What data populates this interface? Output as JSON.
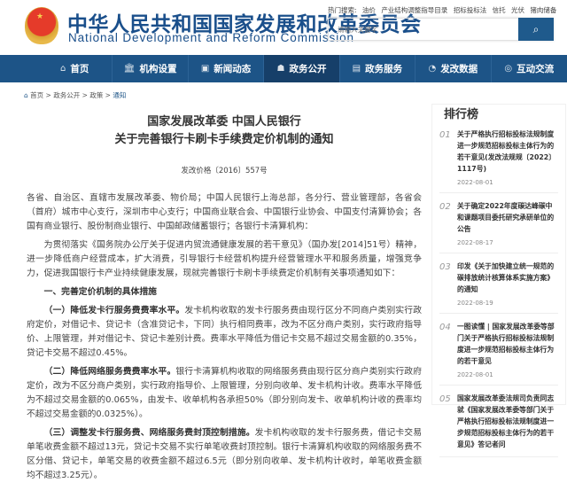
{
  "header": {
    "site_cn": "中华人民共和国国家发展和改革委员会",
    "site_en": "National Development and Reform Commission",
    "hot_label": "热门搜索:",
    "hot_terms": [
      "油价",
      "产业结构调整指导目录",
      "招标投标法",
      "信托",
      "光伏",
      "猪肉储备"
    ],
    "search_placeholder": "请输入关键字"
  },
  "nav": [
    {
      "label": "首页",
      "icon": "⌂"
    },
    {
      "label": "机构设置",
      "icon": "🏛"
    },
    {
      "label": "新闻动态",
      "icon": "▣"
    },
    {
      "label": "政务公开",
      "icon": "☗"
    },
    {
      "label": "政务服务",
      "icon": "▤"
    },
    {
      "label": "发改数据",
      "icon": "◔"
    },
    {
      "label": "互动交流",
      "icon": "◎"
    }
  ],
  "breadcrumb": [
    "首页",
    "政务公开",
    "政策",
    "通知"
  ],
  "article": {
    "title1": "国家发展改革委 中国人民银行",
    "title2": "关于完善银行卡刷卡手续费定价机制的通知",
    "doc_no": "发改价格〔2016〕557号",
    "recipients": "各省、自治区、直辖市发展改革委、物价局；中国人民银行上海总部，各分行、营业管理部，各省会（首府）城市中心支行，深圳市中心支行；中国商业联合会、中国银行业协会、中国支付清算协会；各国有商业银行、股份制商业银行、中国邮政储蓄银行；各银行卡清算机构：",
    "intro": "为贯彻落实《国务院办公厅关于促进内贸流通健康发展的若干意见》（国办发[2014]51号）精神，进一步降低商户经营成本，扩大消费，引导银行卡经营机构提升经营管理水平和服务质量，增强竞争力，促进我国银行卡产业持续健康发展，现就完善银行卡刷卡手续费定价机制有关事项通知如下：",
    "section1": "一、完善定价机制的具体措施",
    "items": [
      {
        "head": "（一）降低发卡行服务费费率水平。",
        "body": "发卡机构收取的发卡行服务费由现行区分不同商户类别实行政府定价，对借记卡、贷记卡（含准贷记卡，下同）执行相同费率，改为不区分商户类别，实行政府指导价、上限管理，并对借记卡、贷记卡差别计费。费率水平降低为借记卡交易不超过交易金额的0.35%，贷记卡交易不超过0.45%。"
      },
      {
        "head": "（二）降低网络服务费费率水平。",
        "body": "银行卡清算机构收取的网络服务费由现行区分商户类别实行政府定价，改为不区分商户类别，实行政府指导价、上限管理，分别向收单、发卡机构计收。费率水平降低为不超过交易金额的0.065%，由发卡、收单机构各承担50%（即分别向发卡、收单机构计收的费率均不超过交易金额的0.0325%）。"
      },
      {
        "head": "（三）调整发卡行服务费、网络服务费封顶控制措施。",
        "body": "发卡机构收取的发卡行服务费，借记卡交易单笔收费金额不超过13元，贷记卡交易不实行单笔收费封顶控制。银行卡清算机构收取的网络服务费不区分借、贷记卡，单笔交易的收费金额不超过6.5元（即分别向收单、发卡机构计收时，单笔收费金额均不超过3.25元）。"
      }
    ]
  },
  "sidebar": {
    "title": "排行榜",
    "items": [
      {
        "num": "01",
        "title": "关于严格执行招标投标法规制度进一步规范招标投标主体行为的若干意见(发改法规规〔2022〕1117号)",
        "date": "2022-08-01"
      },
      {
        "num": "02",
        "title": "关于确定2022年度碳达峰碳中和课题项目委托研究承研单位的公告",
        "date": "2022-08-17"
      },
      {
        "num": "03",
        "title": "印发《关于加快建立统一规范的碳排放统计核算体系实施方案》的通知",
        "date": "2022-08-19"
      },
      {
        "num": "04",
        "title": "一图读懂 | 国家发展改革委等部门关于严格执行招标投标法规制度进一步规范招标投标主体行为的若干意见",
        "date": "2022-08-01"
      },
      {
        "num": "05",
        "title": "国家发展改革委法规司负责同志就《国家发展改革委等部门关于严格执行招标投标法规制度进一步规范招标投标主体行为的若干意见》答记者问",
        "date": ""
      }
    ]
  }
}
